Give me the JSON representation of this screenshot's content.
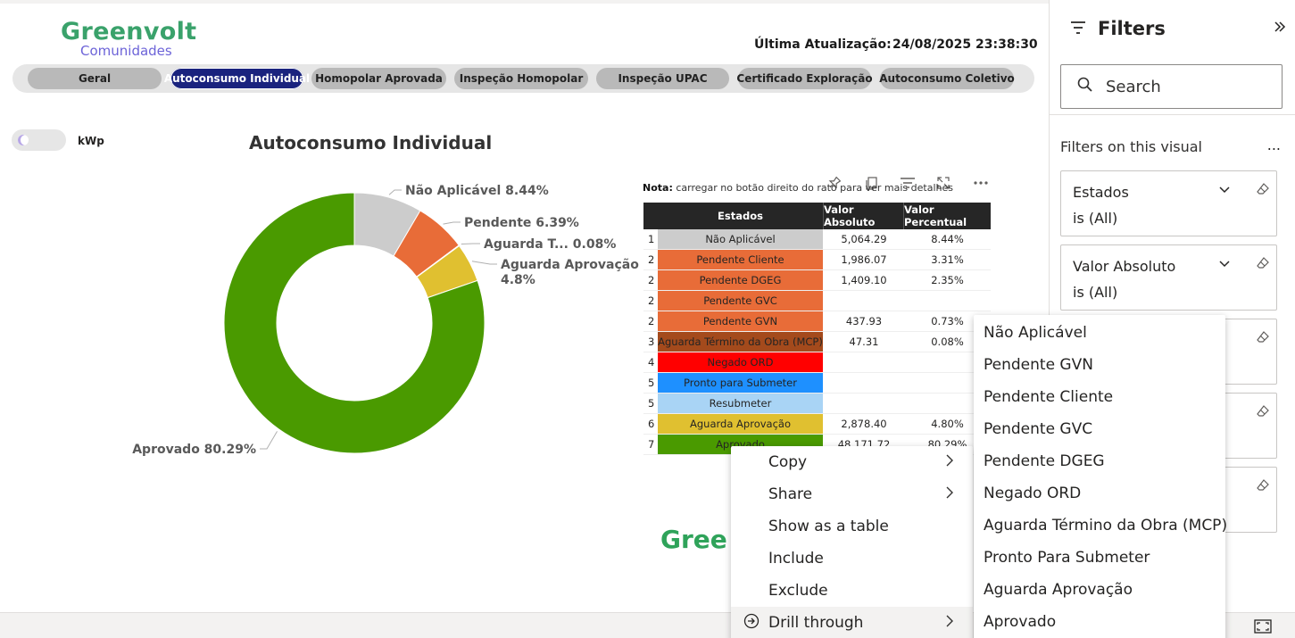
{
  "brand": {
    "logo_main": "Greenvolt",
    "logo_sub": "Comunidades",
    "logo_footer": "Gree"
  },
  "update": {
    "label": "Última Atualização:",
    "value": "24/08/2025 23:38:30"
  },
  "nav_tabs": [
    {
      "label": "Geral",
      "active": false
    },
    {
      "label": "Autoconsumo Individual",
      "active": true
    },
    {
      "label": "Homopolar Aprovada",
      "active": false
    },
    {
      "label": "Inspeção Homopolar",
      "active": false
    },
    {
      "label": "Inspeção UPAC",
      "active": false
    },
    {
      "label": "Certificado Exploração",
      "active": false
    },
    {
      "label": "Autoconsumo Coletivo",
      "active": false
    }
  ],
  "toggle_label": "kWp",
  "chart_data": {
    "type": "pie",
    "variant": "donut",
    "title": "Autoconsumo Individual",
    "slices": [
      {
        "label": "Não Aplicável",
        "percent": 8.44,
        "display": "Não Aplicável 8.44%",
        "color": "#cccccc"
      },
      {
        "label": "Pendente",
        "percent": 6.39,
        "display": "Pendente 6.39%",
        "color": "#e86c38"
      },
      {
        "label": "Aguarda Término da Obra (MCP)",
        "percent": 0.08,
        "display": "Aguarda T... 0.08%",
        "color": "#a44a1c"
      },
      {
        "label": "Aguarda Aprovação",
        "percent": 4.8,
        "display_line1": "Aguarda Aprovação",
        "display_line2": "4.8%",
        "color": "#e0c030"
      },
      {
        "label": "Aprovado",
        "percent": 80.29,
        "display": "Aprovado 80.29%",
        "color": "#4a9a00"
      }
    ]
  },
  "note": {
    "bold": "Nota:",
    "text": " carregar no botão direito do rato para ver mais detalhes"
  },
  "table": {
    "headers": [
      "Estados",
      "Valor Absoluto",
      "Valor Percentual"
    ],
    "rows": [
      {
        "idx": "1",
        "estado": "Não Aplicável",
        "abs": "5,064.29",
        "pct": "8.44%",
        "color": "#cccccc",
        "text_color": "#252423"
      },
      {
        "idx": "2",
        "estado": "Pendente Cliente",
        "abs": "1,986.07",
        "pct": "3.31%",
        "color": "#e86c38",
        "text_color": "#252423"
      },
      {
        "idx": "2",
        "estado": "Pendente DGEG",
        "abs": "1,409.10",
        "pct": "2.35%",
        "color": "#e86c38",
        "text_color": "#252423"
      },
      {
        "idx": "2",
        "estado": "Pendente GVC",
        "abs": "",
        "pct": "",
        "color": "#e86c38",
        "text_color": "#252423"
      },
      {
        "idx": "2",
        "estado": "Pendente GVN",
        "abs": "437.93",
        "pct": "0.73%",
        "color": "#e86c38",
        "text_color": "#252423"
      },
      {
        "idx": "3",
        "estado": "Aguarda Término da Obra (MCP)",
        "abs": "47.31",
        "pct": "0.08%",
        "color": "#a44a1c",
        "text_color": "#252423"
      },
      {
        "idx": "4",
        "estado": "Negado ORD",
        "abs": "",
        "pct": "",
        "color": "#ff0000",
        "text_color": "#252423"
      },
      {
        "idx": "5",
        "estado": "Pronto para Submeter",
        "abs": "",
        "pct": "",
        "color": "#1e90ff",
        "text_color": "#252423"
      },
      {
        "idx": "5",
        "estado": "Resubmeter",
        "abs": "",
        "pct": "",
        "color": "#a9d4f5",
        "text_color": "#252423"
      },
      {
        "idx": "6",
        "estado": "Aguarda Aprovação",
        "abs": "2,878.40",
        "pct": "4.80%",
        "color": "#e0c030",
        "text_color": "#252423"
      },
      {
        "idx": "7",
        "estado": "Aprovado",
        "abs": "48,171.72",
        "pct": "80.29%",
        "color": "#4a9a00",
        "text_color": "#252423"
      }
    ]
  },
  "filters": {
    "title": "Filters",
    "search_placeholder": "Search",
    "section_label": "Filters on this visual",
    "more": "...",
    "cards": [
      {
        "name": "Estados",
        "value": "is (All)"
      },
      {
        "name": "Valor Absoluto",
        "value": "is (All)"
      },
      {
        "name": "",
        "value": ""
      },
      {
        "name": "",
        "value": ""
      },
      {
        "name": "",
        "value": ""
      }
    ]
  },
  "context_menu": {
    "items": [
      {
        "label": "Copy",
        "has_submenu": true
      },
      {
        "label": "Share",
        "has_submenu": true
      },
      {
        "label": "Show as a table",
        "has_submenu": false
      },
      {
        "label": "Include",
        "has_submenu": false
      },
      {
        "label": "Exclude",
        "has_submenu": false
      },
      {
        "label": "Drill through",
        "has_submenu": true,
        "highlighted": true
      }
    ]
  },
  "submenu": {
    "items": [
      "Não Aplicável",
      "Pendente GVN",
      "Pendente Cliente",
      "Pendente GVC",
      "Pendente DGEG",
      "Negado ORD",
      "Aguarda Término da Obra (MCP)",
      "Pronto Para Submeter",
      "Aguarda Aprovação",
      "Aprovado"
    ]
  }
}
